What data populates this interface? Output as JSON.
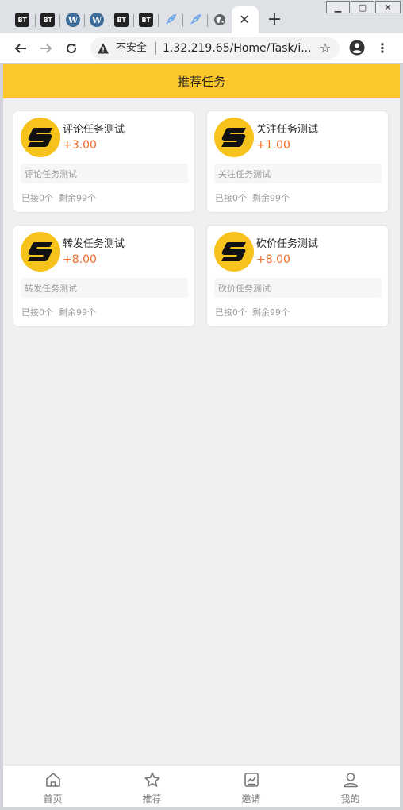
{
  "browser": {
    "tabs": [
      {
        "icon": "bt-icon",
        "label": "BT"
      },
      {
        "icon": "bt-icon",
        "label": "BT"
      },
      {
        "icon": "wordpress-icon",
        "label": "W"
      },
      {
        "icon": "wordpress-icon",
        "label": "W"
      },
      {
        "icon": "bt-icon",
        "label": "BT"
      },
      {
        "icon": "bt-icon",
        "label": "BT"
      },
      {
        "icon": "rocket-icon",
        "label": ""
      },
      {
        "icon": "rocket-icon",
        "label": ""
      },
      {
        "icon": "globe-icon",
        "label": ""
      }
    ],
    "security_label": "不安全",
    "url": "1.32.219.65/Home/Task/i..."
  },
  "header": {
    "title": "推荐任务"
  },
  "tasks": [
    {
      "title": "评论任务测试",
      "reward": "+3.00",
      "desc": "评论任务测试",
      "taken": "已接0个",
      "remaining": "剩余99个"
    },
    {
      "title": "关注任务测试",
      "reward": "+1.00",
      "desc": "关注任务测试",
      "taken": "已接0个",
      "remaining": "剩余99个"
    },
    {
      "title": "转发任务测试",
      "reward": "+8.00",
      "desc": "转发任务测试",
      "taken": "已接0个",
      "remaining": "剩余99个"
    },
    {
      "title": "砍价任务测试",
      "reward": "+8.00",
      "desc": "砍价任务测试",
      "taken": "已接0个",
      "remaining": "剩余99个"
    }
  ],
  "bottom_nav": [
    {
      "label": "首页",
      "icon": "home-icon"
    },
    {
      "label": "推荐",
      "icon": "star-icon"
    },
    {
      "label": "邀请",
      "icon": "invite-icon"
    },
    {
      "label": "我的",
      "icon": "user-icon"
    }
  ],
  "colors": {
    "accent": "#fbc72a",
    "reward": "#f06a28",
    "logo": "#f6c21b"
  }
}
